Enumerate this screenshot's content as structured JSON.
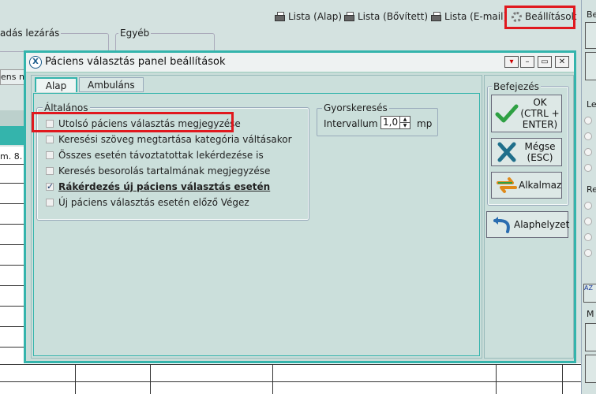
{
  "background": {
    "toplinks": [
      {
        "label": "Lista (Alap)",
        "icon": "printer-icon"
      },
      {
        "label": "Lista (Bővített)",
        "icon": "printer-icon"
      },
      {
        "label": "Lista (E-mail)",
        "icon": "printer-icon"
      },
      {
        "label": "Beállítások",
        "icon": "gear-icon"
      }
    ],
    "group1_title": "adás lezárás",
    "group2_title": "Egyéb",
    "left_fragment_1": "ens ne",
    "left_fragment_2": "m. 8.",
    "right_fragments": [
      "Be",
      "Le",
      "Re",
      "M"
    ]
  },
  "dialog": {
    "title": "Páciens választás panel beállítások",
    "tabs": [
      {
        "label": "Alap",
        "active": true
      },
      {
        "label": "Ambuláns",
        "active": false
      }
    ],
    "general": {
      "legend": "Általános",
      "options": [
        {
          "label": "Utolsó páciens választás megjegyzése",
          "checked": false
        },
        {
          "label": "Keresési szöveg megtartása kategória váltásakor",
          "checked": false
        },
        {
          "label": "Összes esetén távoztatottak lekérdezése is",
          "checked": false
        },
        {
          "label": "Keresés besorolás tartalmának megjegyzése",
          "checked": false
        },
        {
          "label": "Rákérdezés új páciens választás esetén",
          "checked": true
        },
        {
          "label": "Új páciens választás esetén előző Végez",
          "checked": false
        }
      ]
    },
    "quicksearch": {
      "legend": "Gyorskeresés",
      "interval_label": "Intervallum",
      "interval_value": "1,0",
      "unit": "mp"
    },
    "finish": {
      "legend": "Befejezés",
      "ok_label": "OK\n(CTRL +\nENTER)",
      "cancel_label": "Mégse\n(ESC)",
      "apply_label": "Alkalmaz",
      "reset_label": "Alaphelyzet"
    }
  },
  "colors": {
    "highlight": "#e0181e",
    "accent": "#34b4ac"
  }
}
